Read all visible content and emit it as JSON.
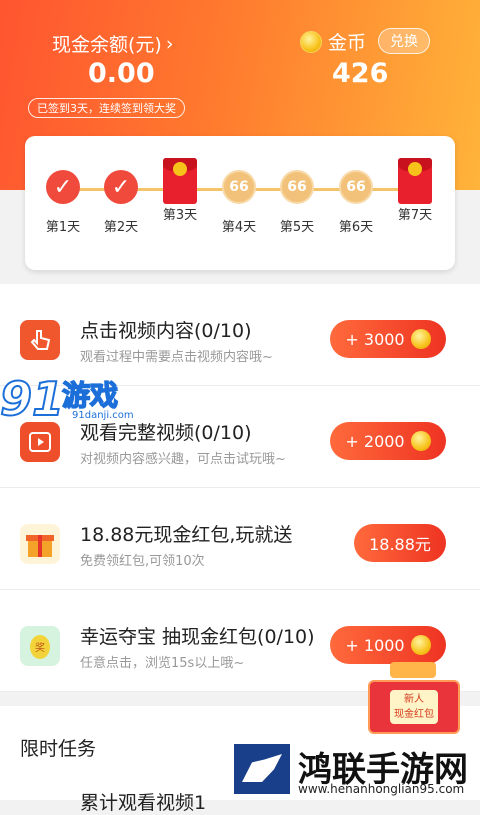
{
  "header": {
    "cash_label": "现金余额(元)",
    "cash_arrow": "›",
    "cash_value": "0.00",
    "coin_label": "金币",
    "exchange_label": "兑换",
    "coin_value": "426",
    "signin_note": "已签到3天，连续签到领大奖"
  },
  "checkin": {
    "days": [
      {
        "label": "第1天",
        "state": "done",
        "mark": "✓"
      },
      {
        "label": "第2天",
        "state": "done",
        "mark": "✓"
      },
      {
        "label": "第3天",
        "state": "gift",
        "mark": ""
      },
      {
        "label": "第4天",
        "state": "pending",
        "mark": "66"
      },
      {
        "label": "第5天",
        "state": "pending",
        "mark": "66"
      },
      {
        "label": "第6天",
        "state": "pending",
        "mark": "66"
      },
      {
        "label": "第7天",
        "state": "gift",
        "mark": ""
      }
    ]
  },
  "tasks": [
    {
      "icon": "tap-hand-icon",
      "title": "点击视频内容(0/10)",
      "subtitle": "观看过程中需要点击视频内容哦~",
      "reward": "+ 3000"
    },
    {
      "icon": "video-play-icon",
      "title": "观看完整视频(0/10)",
      "subtitle": "对视频内容感兴趣，可点击试玩哦~",
      "reward": "+ 2000"
    },
    {
      "icon": "gift-box-icon",
      "title": "18.88元现金红包,玩就送",
      "subtitle": "免费领红包,可领10次",
      "reward": "18.88元"
    },
    {
      "icon": "lucky-egg-icon",
      "title": "幸运夺宝 抽现金红包(0/10)",
      "subtitle": "任意点击，浏览15s以上哦~",
      "reward": "+ 1000"
    }
  ],
  "limited": {
    "title": "限时任务",
    "cut_task": "累计观看视频1"
  },
  "watermark": {
    "number": "91",
    "name": "游戏",
    "url": "91danji.com"
  },
  "newbie_badge": {
    "line1": "新人",
    "line2": "现金红包"
  },
  "corner_logo": {
    "name": "鸿联手游网",
    "url": "www.henanhonglian95.com"
  },
  "colors": {
    "accent": "#ff5530",
    "reward": "#ee3322",
    "coin": "#f7c21a"
  }
}
